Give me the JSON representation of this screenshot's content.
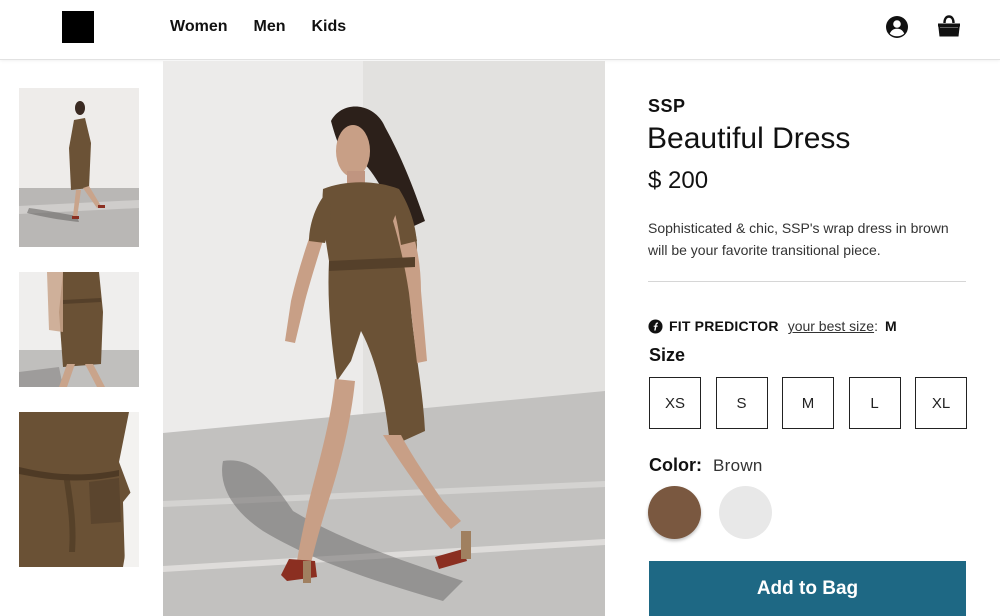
{
  "header": {
    "nav": [
      "Women",
      "Men",
      "Kids"
    ],
    "icons": {
      "logo": "square-logo",
      "account": "account-icon",
      "bag": "shopping-bag-icon"
    }
  },
  "gallery": {
    "thumbnails": [
      "full-length-walking",
      "mid-length-walking",
      "fabric-detail-closeup"
    ],
    "main_image": "woman-walking-in-brown-wrap-dress"
  },
  "product": {
    "brand": "SSP",
    "title": "Beautiful Dress",
    "price": "$ 200",
    "description": "Sophisticated & chic, SSP's wrap dress in brown will be your favorite transitional piece.",
    "fit_predictor": {
      "label": "FIT PREDICTOR",
      "link_text": "your best size",
      "separator": ":",
      "value": "M"
    },
    "size_heading": "Size",
    "sizes": [
      "XS",
      "S",
      "M",
      "L",
      "XL"
    ],
    "color_heading": "Color:",
    "color_value": "Brown",
    "swatches": [
      {
        "name": "Brown",
        "hex": "#7a5840"
      },
      {
        "name": "Light gray",
        "hex": "#e8e8e8"
      }
    ],
    "add_button": "Add to Bag"
  },
  "colors": {
    "accent": "#1e6884",
    "text": "#111111",
    "border": "#222222"
  }
}
